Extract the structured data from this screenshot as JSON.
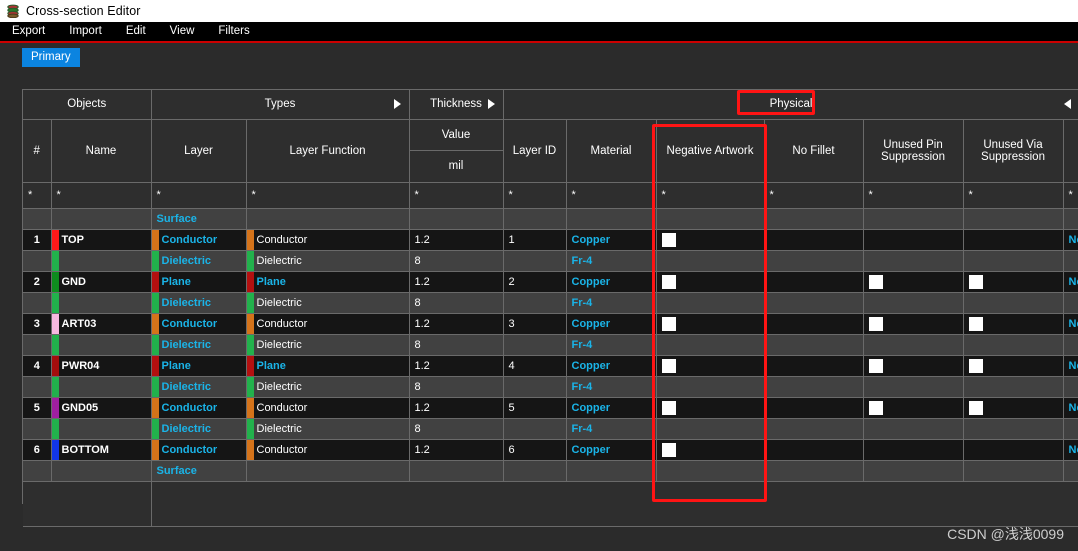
{
  "window": {
    "title": "Cross-section Editor",
    "icon": "layers-icon"
  },
  "menu": [
    {
      "label": "Export"
    },
    {
      "label": "Import"
    },
    {
      "label": "Edit"
    },
    {
      "label": "View"
    },
    {
      "label": "Filters"
    }
  ],
  "tabs": [
    {
      "label": "Primary",
      "active": true
    }
  ],
  "colors": {
    "accent_tab": "#0b84e0",
    "annotation": "#ff1414",
    "cyan_text": "#1ab4e8",
    "menu_underline": "#cc0000"
  },
  "grid": {
    "group_headers": [
      {
        "label": "Objects",
        "arrow": "none"
      },
      {
        "label": "Types",
        "arrow": "right"
      },
      {
        "label": "Thickness",
        "arrow": "right"
      },
      {
        "label": "Physical",
        "arrow": "left",
        "highlighted": true
      }
    ],
    "columns": [
      {
        "label": "#"
      },
      {
        "label": "Name"
      },
      {
        "label": "Layer"
      },
      {
        "label": "Layer Function"
      },
      {
        "label": "Value",
        "sublabel": "mil"
      },
      {
        "label": "Layer ID"
      },
      {
        "label": "Material"
      },
      {
        "label": "Negative Artwork",
        "highlighted": true
      },
      {
        "label": "No Fillet"
      },
      {
        "label": "Unused Pin Suppression"
      },
      {
        "label": "Unused Via Suppression"
      },
      {
        "label": ""
      }
    ],
    "filter_row": [
      "*",
      "*",
      "*",
      "*",
      "*",
      "*",
      "*",
      "*",
      "*",
      "*",
      "*",
      "*"
    ],
    "rows": [
      {
        "kind": "surface",
        "num": "",
        "name": "",
        "chip": "",
        "layer": "Surface",
        "layer_function": "",
        "value": "",
        "layer_id": "",
        "material": "",
        "negative_artwork": false,
        "no_fillet": false,
        "unused_pin": false,
        "unused_via": false,
        "last": ""
      },
      {
        "kind": "conductor",
        "num": "1",
        "name": "TOP",
        "chip": "#ff1a1a",
        "layer": "Conductor",
        "layer_function": "Conductor",
        "value": "1.2",
        "layer_id": "1",
        "material": "Copper",
        "negative_artwork": true,
        "no_fillet": false,
        "unused_pin": false,
        "unused_via": false,
        "last": "No"
      },
      {
        "kind": "dielectric",
        "num": "",
        "name": "",
        "chip": "#22b14c",
        "layer": "Dielectric",
        "layer_function": "Dielectric",
        "value": "8",
        "layer_id": "",
        "material": "Fr-4",
        "negative_artwork": false,
        "no_fillet": false,
        "unused_pin": false,
        "unused_via": false,
        "last": ""
      },
      {
        "kind": "plane",
        "num": "2",
        "name": "GND",
        "chip": "#0e8c1e",
        "layer": "Plane",
        "layer_function": "Plane",
        "value": "1.2",
        "layer_id": "2",
        "material": "Copper",
        "negative_artwork": true,
        "no_fillet": false,
        "unused_pin": true,
        "unused_via": true,
        "last": "No"
      },
      {
        "kind": "dielectric",
        "num": "",
        "name": "",
        "chip": "#22b14c",
        "layer": "Dielectric",
        "layer_function": "Dielectric",
        "value": "8",
        "layer_id": "",
        "material": "Fr-4",
        "negative_artwork": false,
        "no_fillet": false,
        "unused_pin": false,
        "unused_via": false,
        "last": ""
      },
      {
        "kind": "conductor",
        "num": "3",
        "name": "ART03",
        "chip": "#f7b8e0",
        "layer": "Conductor",
        "layer_function": "Conductor",
        "value": "1.2",
        "layer_id": "3",
        "material": "Copper",
        "negative_artwork": true,
        "no_fillet": false,
        "unused_pin": true,
        "unused_via": true,
        "last": "No"
      },
      {
        "kind": "dielectric",
        "num": "",
        "name": "",
        "chip": "#22b14c",
        "layer": "Dielectric",
        "layer_function": "Dielectric",
        "value": "8",
        "layer_id": "",
        "material": "Fr-4",
        "negative_artwork": false,
        "no_fillet": false,
        "unused_pin": false,
        "unused_via": false,
        "last": ""
      },
      {
        "kind": "plane",
        "num": "4",
        "name": "PWR04",
        "chip": "#a40d0d",
        "layer": "Plane",
        "layer_function": "Plane",
        "value": "1.2",
        "layer_id": "4",
        "material": "Copper",
        "negative_artwork": true,
        "no_fillet": false,
        "unused_pin": true,
        "unused_via": true,
        "last": "No"
      },
      {
        "kind": "dielectric",
        "num": "",
        "name": "",
        "chip": "#22b14c",
        "layer": "Dielectric",
        "layer_function": "Dielectric",
        "value": "8",
        "layer_id": "",
        "material": "Fr-4",
        "negative_artwork": false,
        "no_fillet": false,
        "unused_pin": false,
        "unused_via": false,
        "last": ""
      },
      {
        "kind": "conductor",
        "num": "5",
        "name": "GND05",
        "chip": "#a01fa0",
        "layer": "Conductor",
        "layer_function": "Conductor",
        "value": "1.2",
        "layer_id": "5",
        "material": "Copper",
        "negative_artwork": true,
        "no_fillet": false,
        "unused_pin": true,
        "unused_via": true,
        "last": "No"
      },
      {
        "kind": "dielectric",
        "num": "",
        "name": "",
        "chip": "#22b14c",
        "layer": "Dielectric",
        "layer_function": "Dielectric",
        "value": "8",
        "layer_id": "",
        "material": "Fr-4",
        "negative_artwork": false,
        "no_fillet": false,
        "unused_pin": false,
        "unused_via": false,
        "last": ""
      },
      {
        "kind": "conductor",
        "num": "6",
        "name": "BOTTOM",
        "chip": "#1236e8",
        "layer": "Conductor",
        "layer_function": "Conductor",
        "value": "1.2",
        "layer_id": "6",
        "material": "Copper",
        "negative_artwork": true,
        "no_fillet": false,
        "unused_pin": false,
        "unused_via": false,
        "last": "No"
      },
      {
        "kind": "surface",
        "num": "",
        "name": "",
        "chip": "",
        "layer": "Surface",
        "layer_function": "",
        "value": "",
        "layer_id": "",
        "material": "",
        "negative_artwork": false,
        "no_fillet": false,
        "unused_pin": false,
        "unused_via": false,
        "last": ""
      }
    ]
  },
  "watermark": {
    "text": "CSDN @浅浅0099"
  }
}
